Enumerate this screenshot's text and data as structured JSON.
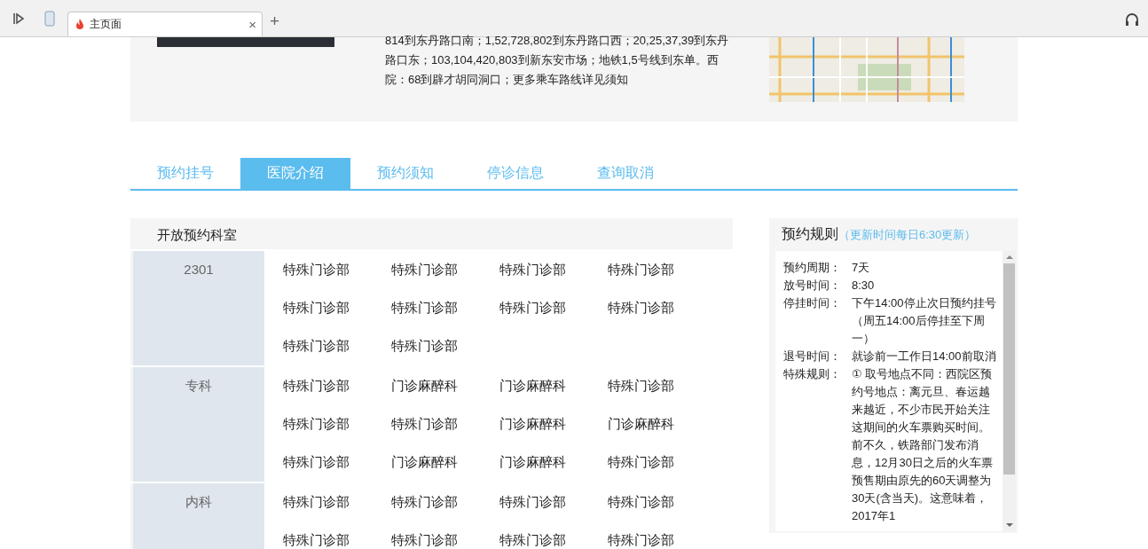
{
  "browser": {
    "tab_title": "主页面",
    "new_tab": "+",
    "close": "×"
  },
  "info": {
    "transit_text": "814到东丹路口南；1,52,728,802到东丹路口西；20,25,37,39到东丹路口东；103,104,420,803到新东安市场；地铁1,5号线到东单。西院：68到辟才胡同洞口；更多乘车路线详见须知"
  },
  "tabs": [
    {
      "label": "预约挂号",
      "selected": false
    },
    {
      "label": "医院介绍",
      "selected": true
    },
    {
      "label": "预约须知",
      "selected": false
    },
    {
      "label": "停诊信息",
      "selected": false
    },
    {
      "label": "查询取消",
      "selected": false
    }
  ],
  "departments": {
    "title": "开放预约科室",
    "groups": [
      {
        "name": "2301",
        "items": [
          "特殊门诊部",
          "特殊门诊部",
          "特殊门诊部",
          "特殊门诊部",
          "特殊门诊部",
          "特殊门诊部",
          "特殊门诊部",
          "特殊门诊部",
          "特殊门诊部",
          "特殊门诊部"
        ]
      },
      {
        "name": "专科",
        "items": [
          "特殊门诊部",
          "门诊麻醉科",
          "门诊麻醉科",
          "特殊门诊部",
          "特殊门诊部",
          "特殊门诊部",
          "门诊麻醉科",
          "门诊麻醉科",
          "特殊门诊部",
          "门诊麻醉科",
          "门诊麻醉科",
          "特殊门诊部"
        ]
      },
      {
        "name": "内科",
        "items": [
          "特殊门诊部",
          "特殊门诊部",
          "特殊门诊部",
          "特殊门诊部",
          "特殊门诊部",
          "特殊门诊部",
          "特殊门诊部",
          "特殊门诊部"
        ]
      }
    ]
  },
  "rules": {
    "title": "预约规则",
    "note": "（更新时间每日6:30更新）",
    "items": [
      {
        "label": "预约周期：",
        "value": "7天"
      },
      {
        "label": "放号时间：",
        "value": "8:30"
      },
      {
        "label": "停挂时间：",
        "value": "下午14:00停止次日预约挂号（周五14:00后停挂至下周一）"
      },
      {
        "label": "退号时间：",
        "value": "就诊前一工作日14:00前取消"
      },
      {
        "label": "特殊规则：",
        "value": "① 取号地点不同：西院区预约号地点：离元旦、春运越来越近，不少市民开始关注这期间的火车票购买时间。前不久，铁路部门发布消息，12月30日之后的火车票预售期由原先的60天调整为30天(含当天)。这意味着，2017年1"
      }
    ]
  }
}
